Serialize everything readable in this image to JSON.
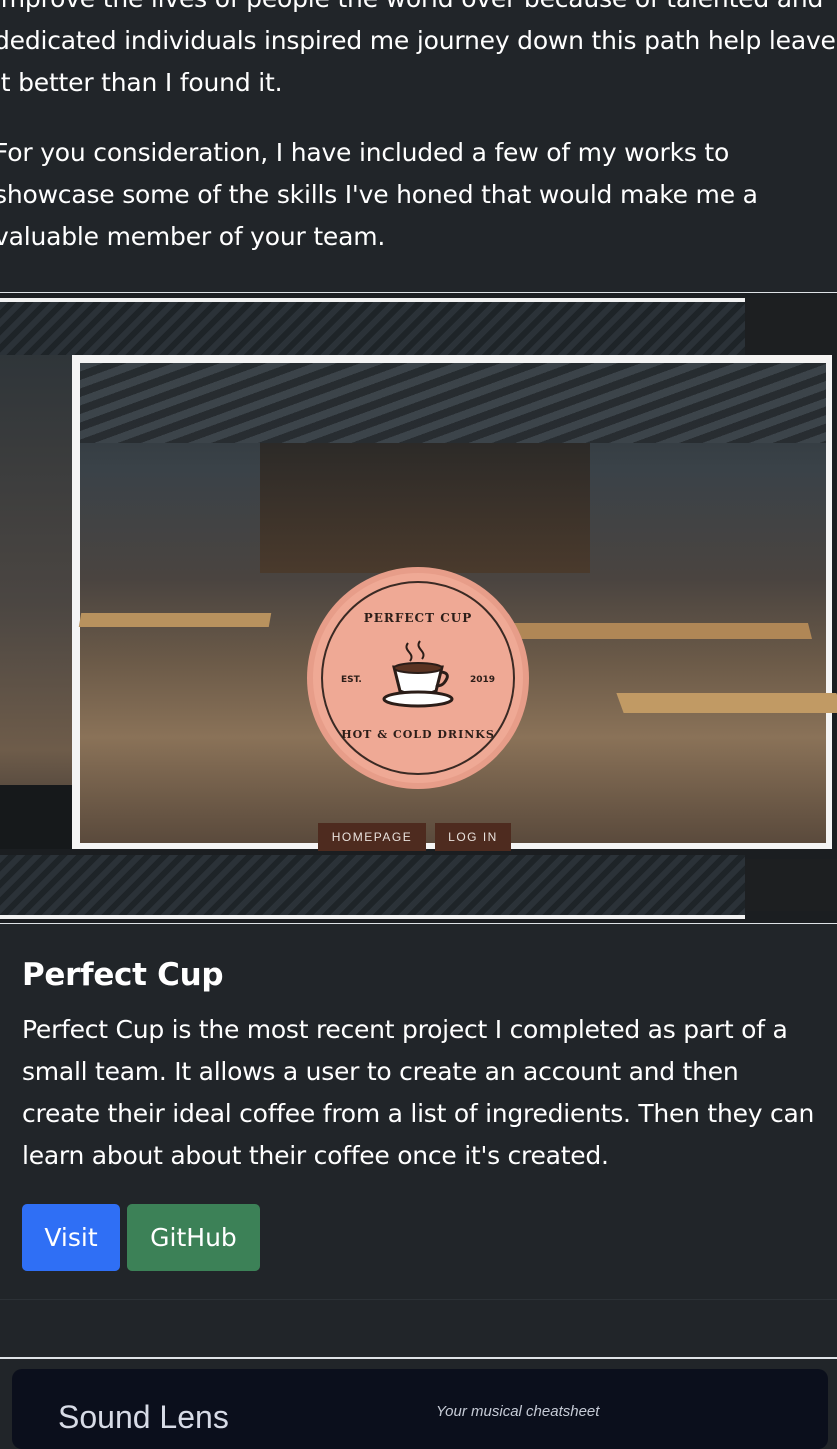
{
  "intro": {
    "paragraph1_line1": "improve the lives of people the world over because of talented and",
    "paragraph1_line2": "dedicated individuals inspired me journey down this path help leave",
    "paragraph1_line3": "it better than I found it.",
    "paragraph2_line1": "For you consideration, I have included a few of my works to",
    "paragraph2_line2": "showcase some of the skills I've honed that would make me a",
    "paragraph2_line3": "valuable member of your team."
  },
  "project": {
    "screenshot": {
      "logo_top": "PERFECT CUP",
      "logo_bottom": "HOT & COLD DRINKS",
      "logo_est": "EST.",
      "logo_year": "2019",
      "nav_home": "HOMEPAGE",
      "nav_login": "LOG IN"
    },
    "title": "Perfect Cup",
    "description_line1": "Perfect Cup is the most recent project I completed as part of a",
    "description_line2": "small team. It allows a user to create an account and then",
    "description_line3": "create their ideal coffee from a list of ingredients. Then they can",
    "description_line4": "learn about about their coffee once it's created.",
    "visit_label": "Visit",
    "github_label": "GitHub"
  },
  "next_project": {
    "brand": "Sound Lens",
    "tagline": "Your musical cheatsheet"
  },
  "colors": {
    "background": "#212529",
    "visit_button": "#2f6ff5",
    "github_button": "#3c8157",
    "logo": "#efa995"
  }
}
